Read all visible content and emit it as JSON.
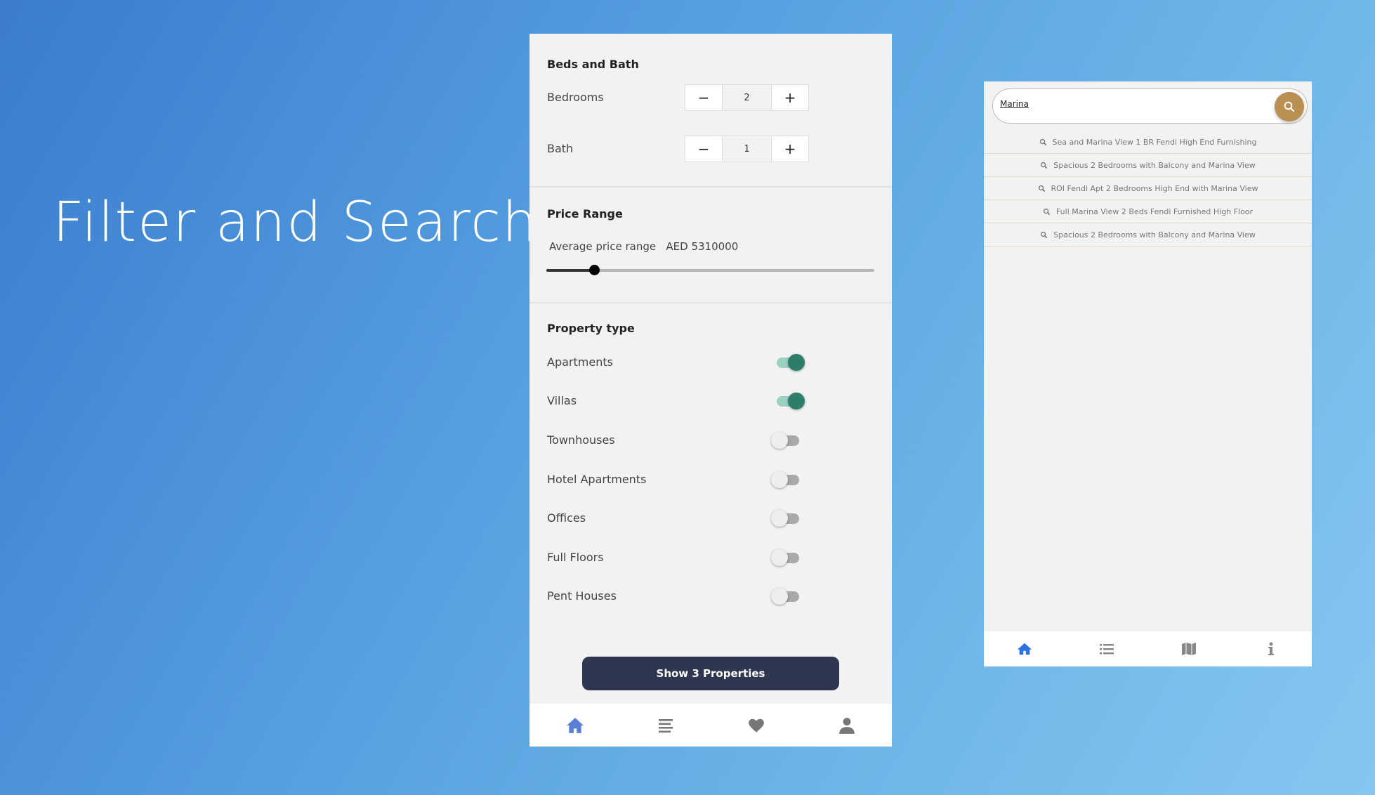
{
  "hero": {
    "title": "Filter and Search"
  },
  "filter": {
    "beds_title": "Beds and Bath",
    "bedrooms": {
      "label": "Bedrooms",
      "value": "2",
      "minus": "−",
      "plus": "+"
    },
    "bath": {
      "label": "Bath",
      "value": "1",
      "minus": "−",
      "plus": "+"
    },
    "price_title": "Price Range",
    "price_label": "Average price range",
    "price_value": "AED 5310000",
    "price_slider_fraction": 0.146,
    "property_title": "Property type",
    "types": [
      {
        "label": "Apartments",
        "on": true
      },
      {
        "label": "Villas",
        "on": true
      },
      {
        "label": "Townhouses",
        "on": false
      },
      {
        "label": "Hotel Apartments",
        "on": false
      },
      {
        "label": "Offices",
        "on": false
      },
      {
        "label": "Full Floors",
        "on": false
      },
      {
        "label": "Pent Houses",
        "on": false
      }
    ],
    "show_button": "Show 3 Properties",
    "nav": [
      "home-icon",
      "list-icon",
      "heart-icon",
      "user-icon"
    ],
    "active_color": "#5b7fd6",
    "toggle_color": "#2e7d6a"
  },
  "search": {
    "query": "Marina",
    "button_color": "#b98f52",
    "suggestions": [
      "Sea and Marina View 1 BR Fendi High End Furnishing",
      "Spacious 2 Bedrooms with Balcony and Marina View",
      "ROI Fendi Apt 2 Bedrooms High End with Marina View",
      "Full Marina View 2 Beds Fendi Furnished High Floor",
      "Spacious 2 Bedrooms with Balcony and Marina View"
    ],
    "nav": [
      "home-icon",
      "list-icon",
      "map-icon",
      "info-icon"
    ],
    "active_color": "#2a72e6"
  }
}
